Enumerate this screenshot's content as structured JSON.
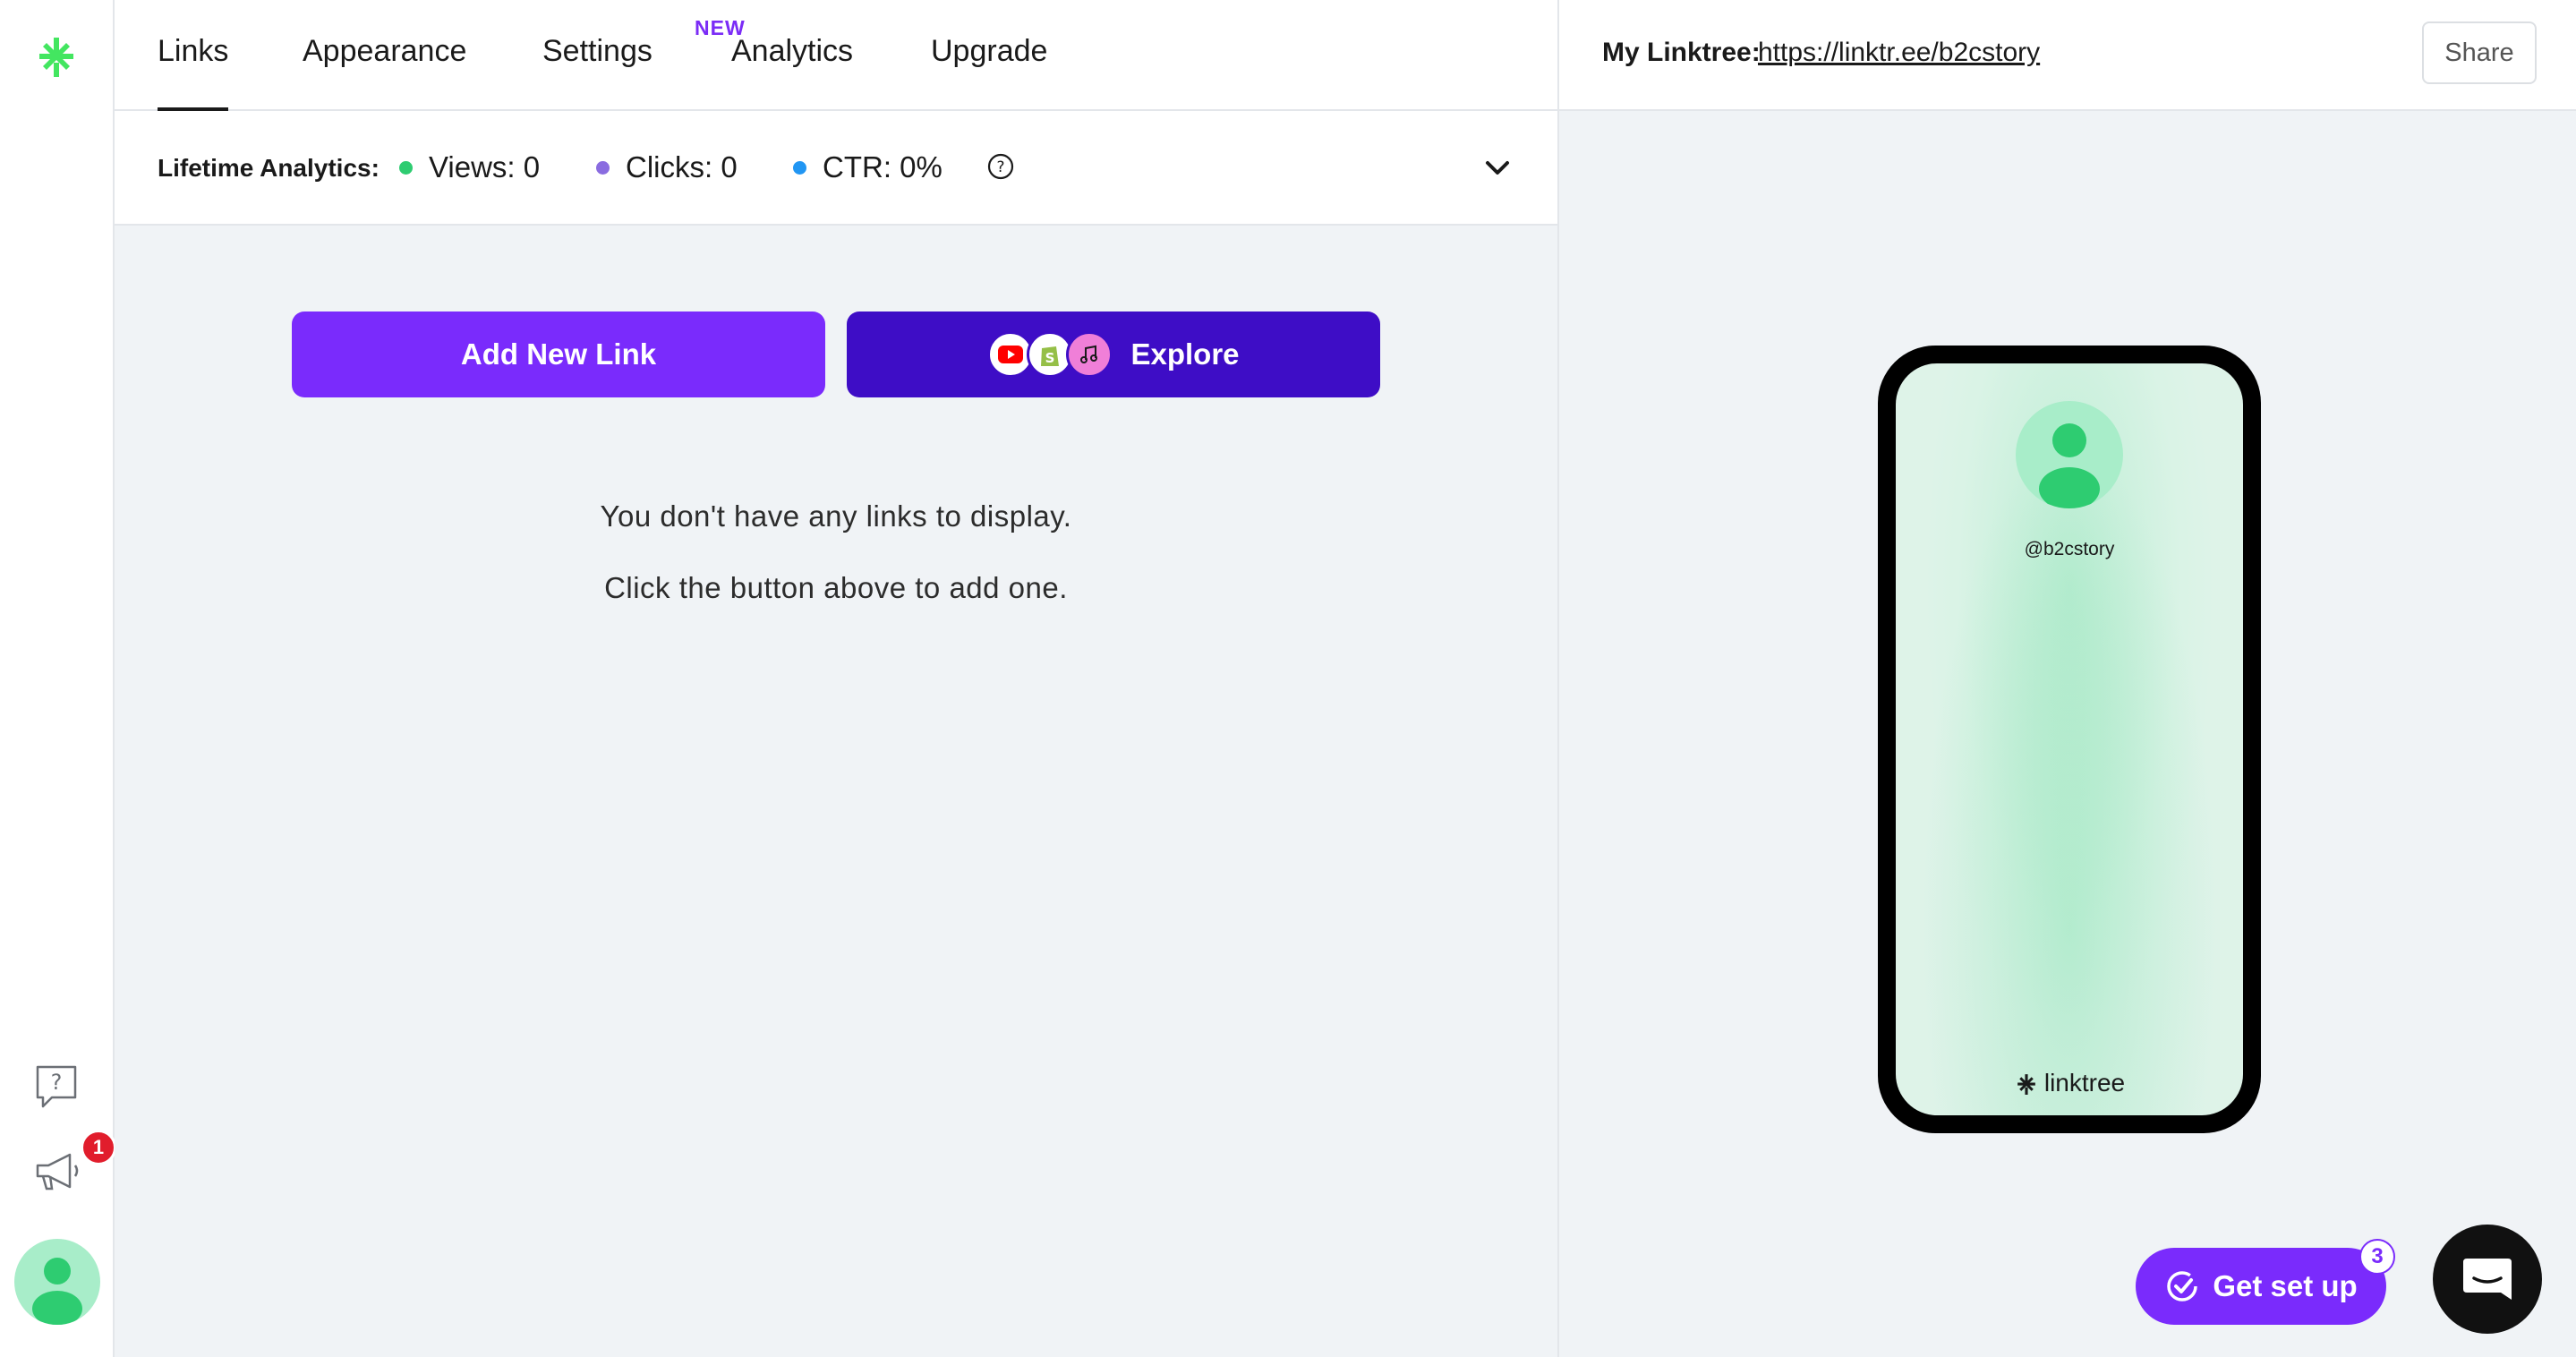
{
  "nav": {
    "tabs": [
      {
        "label": "Links"
      },
      {
        "label": "Appearance"
      },
      {
        "label": "Settings"
      },
      {
        "label": "Analytics",
        "badge": "NEW"
      },
      {
        "label": "Upgrade"
      }
    ],
    "active_tab": "Links"
  },
  "analytics": {
    "title": "Lifetime Analytics:",
    "views": "Views: 0",
    "clicks": "Clicks: 0",
    "ctr": "CTR: 0%",
    "colors": {
      "views": "#2ecc71",
      "clicks": "#8a6ce0",
      "ctr": "#2196f3"
    }
  },
  "main": {
    "add_button": "Add New Link",
    "explore_button": "Explore",
    "explore_icons": [
      "youtube-icon",
      "shopify-icon",
      "music-icon"
    ],
    "empty_line1": "You don't have any links to display.",
    "empty_line2": "Click the button above to add one."
  },
  "preview": {
    "my_label": "My Linktree:",
    "url": "https://linktr.ee/b2cstory",
    "share_label": "Share",
    "handle": "@b2cstory",
    "brand": "linktree"
  },
  "sidebar": {
    "notification_count": "1"
  },
  "footer": {
    "get_set_up": "Get set up",
    "get_set_up_count": "3"
  },
  "colors": {
    "accent": "#7a2bfc",
    "explore": "#3e0dc6",
    "logo_green": "#43e660"
  }
}
